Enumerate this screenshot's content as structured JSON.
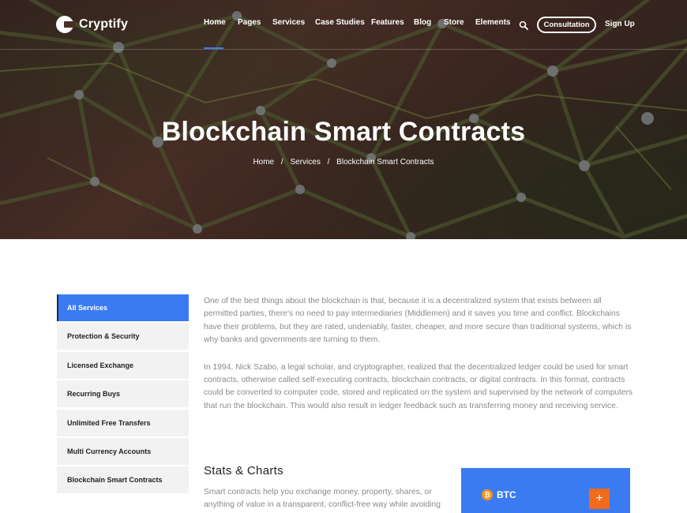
{
  "brand": {
    "name": "Cryptify"
  },
  "nav": {
    "items": [
      "Home",
      "Pages",
      "Services",
      "Case Studies",
      "Features",
      "Blog",
      "Store",
      "Elements"
    ],
    "consultation_label": "Consultation",
    "signup_label": "Sign Up",
    "search_icon": "search-icon"
  },
  "hero": {
    "title": "Blockchain Smart Contracts",
    "breadcrumb": [
      "Home",
      "Services",
      "Blockchain Smart Contracts"
    ],
    "breadcrumb_sep": "/"
  },
  "sidebar": {
    "items": [
      "All Services",
      "Protection & Security",
      "Licensed Exchange",
      "Recurring Buys",
      "Unlimited Free Transfers",
      "Multi Currency Accounts",
      "Blockchain Smart Contracts"
    ],
    "active_index": 0
  },
  "content": {
    "paragraphs": [
      "One of the best things about the blockchain is that, because it is a decentralized system that exists between all permitted parties, there’s no need to pay intermediaries (Middlemen) and it saves you time and conflict. Blockchains have their problems, but they are rated, undeniably, faster, cheaper, and more secure than traditional systems, which is why banks and governments are turning to them.",
      "In 1994, Nick Szabo, a legal scholar, and cryptographer, realized that the decentralized ledger could be used for smart contracts, otherwise called self-executing contracts, blockchain contracts, or digital contracts. In this format, contracts could be converted to computer code, stored and replicated on the system and supervised by the network of computers that run the blockchain. This would also result in ledger feedback such as transferring money and receiving service."
    ],
    "section_title": "Stats & Charts",
    "section_text": "Smart contracts help you exchange money, property, shares, or anything of value in a transparent, conflict-free way while avoiding"
  },
  "btc_card": {
    "label": "BTC",
    "coin_glyph": "₿",
    "plus_label": "+"
  },
  "colors": {
    "accent": "#3b7bf2",
    "orange": "#f26a1b",
    "bitcoin": "#f7931a"
  }
}
